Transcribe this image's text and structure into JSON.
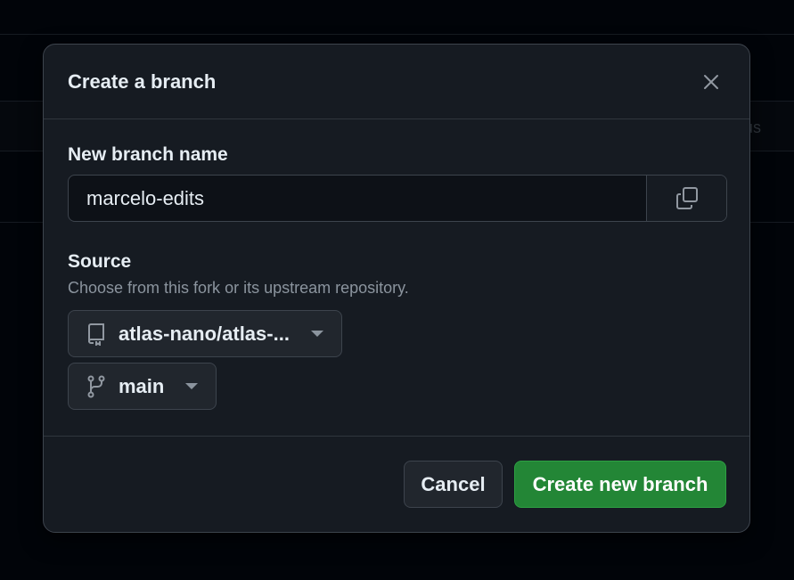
{
  "background": {
    "ghost_text": "us"
  },
  "dialog": {
    "title": "Create a branch",
    "close_icon": "close-icon",
    "branch_name": {
      "label": "New branch name",
      "value": "marcelo-edits"
    },
    "copy_icon": "copy-icon",
    "source": {
      "label": "Source",
      "hint": "Choose from this fork or its upstream repository.",
      "repo": {
        "icon": "repo-icon",
        "value": "atlas-nano/atlas-..."
      },
      "branch": {
        "icon": "git-branch-icon",
        "value": "main"
      }
    },
    "footer": {
      "cancel_label": "Cancel",
      "create_label": "Create new branch"
    }
  },
  "colors": {
    "background": "#010409",
    "dialog": "#161b22",
    "primary_button": "#238636",
    "muted_text": "#8b949e"
  }
}
